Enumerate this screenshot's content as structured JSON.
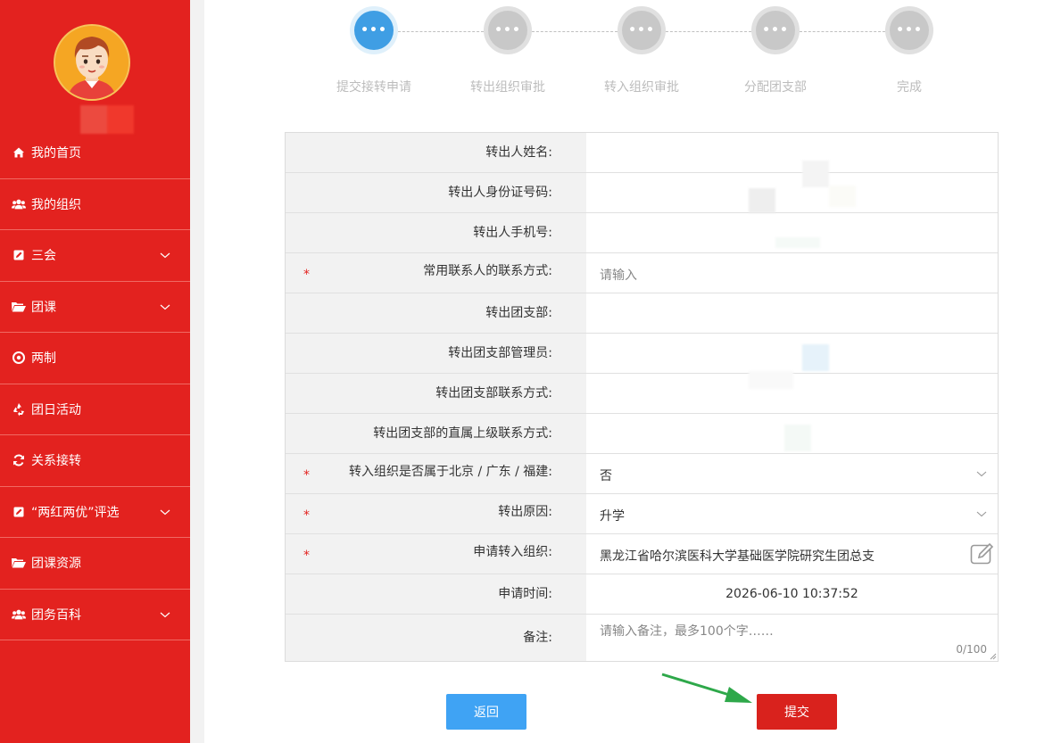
{
  "sidebar": {
    "items": [
      {
        "label": "我的首页",
        "icon": "home-icon",
        "has_submenu": false
      },
      {
        "label": "我的组织",
        "icon": "users-icon",
        "has_submenu": false
      },
      {
        "label": "三会",
        "icon": "edit-icon",
        "has_submenu": true
      },
      {
        "label": "团课",
        "icon": "folder-open-icon",
        "has_submenu": true
      },
      {
        "label": "两制",
        "icon": "target-icon",
        "has_submenu": false
      },
      {
        "label": "团日活动",
        "icon": "recycle-icon",
        "has_submenu": false
      },
      {
        "label": "关系接转",
        "icon": "refresh-icon",
        "has_submenu": false
      },
      {
        "label": "“两红两优”评选",
        "icon": "edit-icon",
        "has_submenu": true
      },
      {
        "label": "团课资源",
        "icon": "folder-open-icon",
        "has_submenu": false
      },
      {
        "label": "团务百科",
        "icon": "users-icon",
        "has_submenu": true
      }
    ]
  },
  "steps": {
    "dots": "•••",
    "items": [
      {
        "label": "提交接转申请",
        "active": true
      },
      {
        "label": "转出组织审批",
        "active": false
      },
      {
        "label": "转入组织审批",
        "active": false
      },
      {
        "label": "分配团支部",
        "active": false
      },
      {
        "label": "完成",
        "active": false
      }
    ]
  },
  "form": {
    "name_label": "转出人姓名:",
    "id_label": "转出人身份证号码:",
    "phone_label": "转出人手机号:",
    "contact_label": "常用联系人的联系方式:",
    "contact_placeholder": "请输入",
    "branch_label": "转出团支部:",
    "admin_label": "转出团支部管理员:",
    "branch_contact_label": "转出团支部联系方式:",
    "superior_contact_label": "转出团支部的直属上级联系方式:",
    "region_label": "转入组织是否属于北京 / 广东 / 福建:",
    "region_value": "否",
    "reason_label": "转出原因:",
    "reason_value": "升学",
    "target_label": "申请转入组织:",
    "target_value": "黑龙江省哈尔滨医科大学基础医学院研究生团总支",
    "time_label": "申请时间:",
    "time_value": "2026-06-10 10:37:52",
    "remark_label": "备注:",
    "remark_placeholder": "请输入备注，最多100个字……",
    "remark_counter": "0/100",
    "required_mark": "*"
  },
  "buttons": {
    "back": "返回",
    "submit": "提交"
  },
  "colors": {
    "sidebar_bg": "#e3221f",
    "active_step": "#3f9ee4",
    "back_button": "#3fa3f4",
    "submit_button": "#d9221d",
    "arrow": "#2ea84a"
  }
}
